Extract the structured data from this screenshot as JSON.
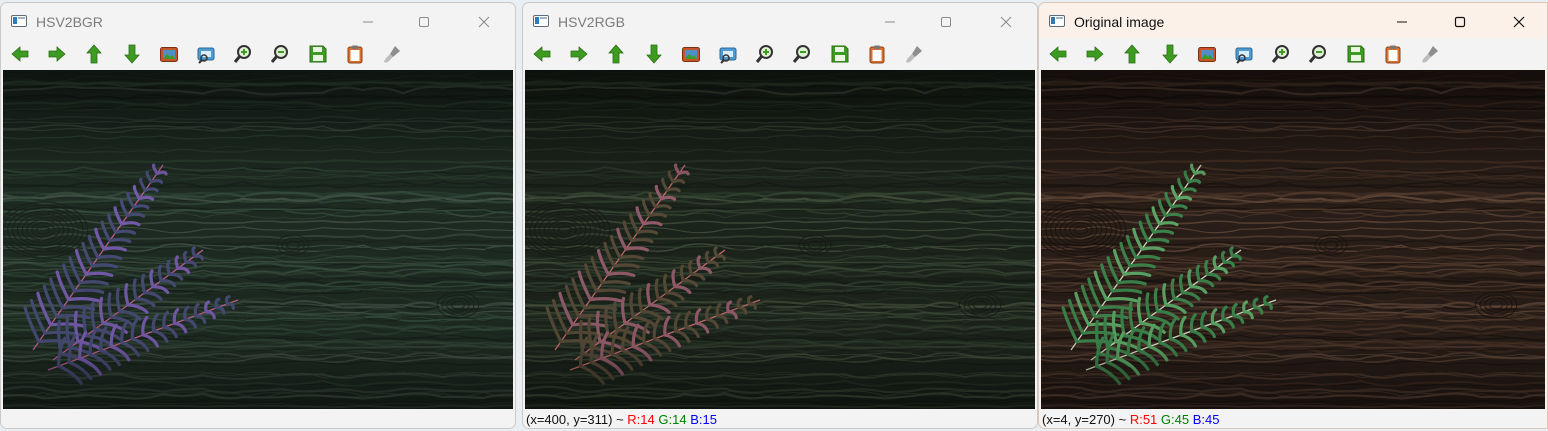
{
  "windows": [
    {
      "title": "HSV2BGR",
      "status": {
        "coords": "",
        "r_text": "",
        "g_text": "",
        "b_text": ""
      }
    },
    {
      "title": "HSV2RGB",
      "status": {
        "coords": "(x=400, y=311) ~ ",
        "r_text": "R:14",
        "g_text": "G:14",
        "b_text": "B:15"
      }
    },
    {
      "title": "Original image",
      "status": {
        "coords": "(x=4, y=270) ~ ",
        "r_text": "R:51",
        "g_text": "G:45",
        "b_text": "B:45"
      }
    }
  ],
  "toolbar_icons": [
    "arrow-left-icon",
    "arrow-right-icon",
    "arrow-up-icon",
    "arrow-down-icon",
    "image-icon",
    "zoom-fit-icon",
    "zoom-in-icon",
    "zoom-out-icon",
    "save-icon",
    "clipboard-icon",
    "brush-icon"
  ],
  "colors": {
    "toolbar_green": "#3d9a1f",
    "status_red": "#ff0000",
    "status_green": "#008000",
    "status_blue": "#0000ff",
    "active_titlebar": "#fbf1e8"
  }
}
